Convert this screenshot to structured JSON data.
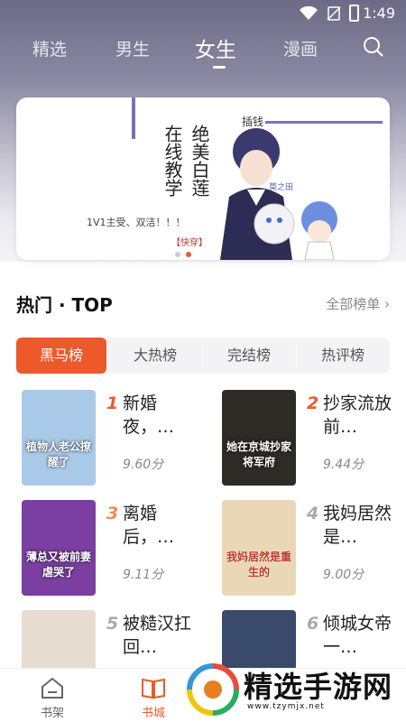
{
  "status_bar": {
    "time": "1:49"
  },
  "tabs": [
    {
      "label": "精选"
    },
    {
      "label": "男生"
    },
    {
      "label": "女生"
    },
    {
      "label": "漫画"
    }
  ],
  "active_tab_index": 2,
  "banner": {
    "title_col1": "在线教学",
    "title_col2": "绝美白莲",
    "tag": "【快穿】",
    "subtitle": "1V1主受、双洁！！！",
    "author": "插钱",
    "character_label": "莫之田",
    "page_count": 2,
    "active_page": 2
  },
  "section": {
    "title": "热门 · TOP",
    "more_label": "全部榜单 ›"
  },
  "rank_tabs": [
    {
      "label": "黑马榜"
    },
    {
      "label": "大热榜"
    },
    {
      "label": "完结榜"
    },
    {
      "label": "热评榜"
    }
  ],
  "books": [
    {
      "rank": "1",
      "title": "新婚夜，…",
      "score": "9.60分",
      "cover_text": "植物人老公撩醒了",
      "cover_color": "#a9c9e8",
      "rank_color": "#ec5a2c"
    },
    {
      "rank": "2",
      "title": "抄家流放前…",
      "score": "9.44分",
      "cover_text": "她在京城抄家将军府",
      "cover_color": "#2e2a26",
      "rank_color": "#ec5a2c"
    },
    {
      "rank": "3",
      "title": "离婚后，…",
      "score": "9.11分",
      "cover_text": "薄总又被前妻虐哭了",
      "cover_color": "#7a3fa0",
      "rank_color": "#f08b5a"
    },
    {
      "rank": "4",
      "title": "我妈居然是…",
      "score": "9.00分",
      "cover_text": "我妈居然是重生的",
      "cover_color": "#e9d7b5",
      "rank_color": "#aaaaaa"
    },
    {
      "rank": "5",
      "title": "被糙汉扛回…",
      "score": "",
      "cover_text": "",
      "cover_color": "#e6ddd0",
      "rank_color": "#aaaaaa"
    },
    {
      "rank": "6",
      "title": "倾城女帝一…",
      "score": "",
      "cover_text": "",
      "cover_color": "#3a4a6b",
      "rank_color": "#aaaaaa"
    }
  ],
  "bottom_nav": [
    {
      "label": "书架",
      "color": "#666666"
    },
    {
      "label": "书城",
      "color": "#ec5a2c"
    }
  ],
  "watermark": {
    "text": "精选手游网",
    "url": "www.tzymjx.net"
  }
}
